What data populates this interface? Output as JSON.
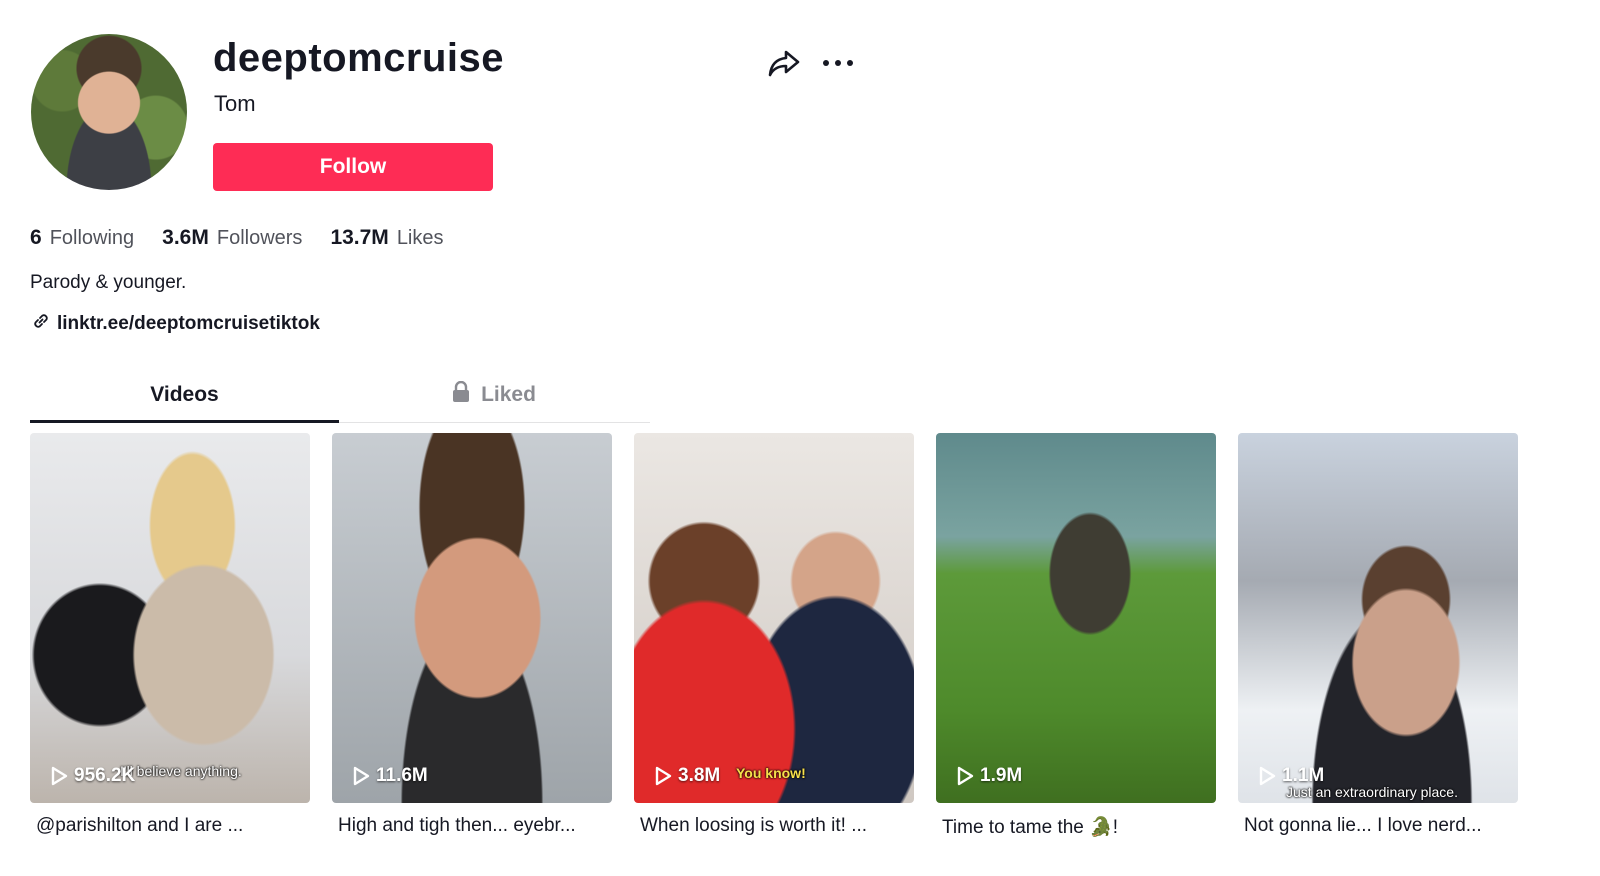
{
  "profile": {
    "username": "deeptomcruise",
    "nickname": "Tom",
    "follow_label": "Follow",
    "bio": "Parody & younger.",
    "link": "linktr.ee/deeptomcruisetiktok"
  },
  "stats": [
    {
      "value": "6",
      "label": "Following"
    },
    {
      "value": "3.6M",
      "label": "Followers"
    },
    {
      "value": "13.7M",
      "label": "Likes"
    }
  ],
  "tabs": [
    {
      "label": "Videos",
      "active": true
    },
    {
      "label": "Liked",
      "active": false,
      "icon": "lock-icon"
    }
  ],
  "videos": [
    {
      "views": "956.2K",
      "overlay": "I'll believe anything.",
      "desc": "@parishilton and I are ..."
    },
    {
      "views": "11.6M",
      "overlay": "",
      "desc": "High and tigh then... eyebr..."
    },
    {
      "views": "3.8M",
      "overlay": "You know!",
      "desc": "When loosing is worth it! ..."
    },
    {
      "views": "1.9M",
      "overlay": "",
      "desc": "Time to tame the 🐊!"
    },
    {
      "views": "1.1M",
      "overlay": "Just an extraordinary place.",
      "desc": "Not gonna lie... I love nerd..."
    }
  ],
  "colors": {
    "accent": "#fe2c55",
    "text": "#161823"
  }
}
